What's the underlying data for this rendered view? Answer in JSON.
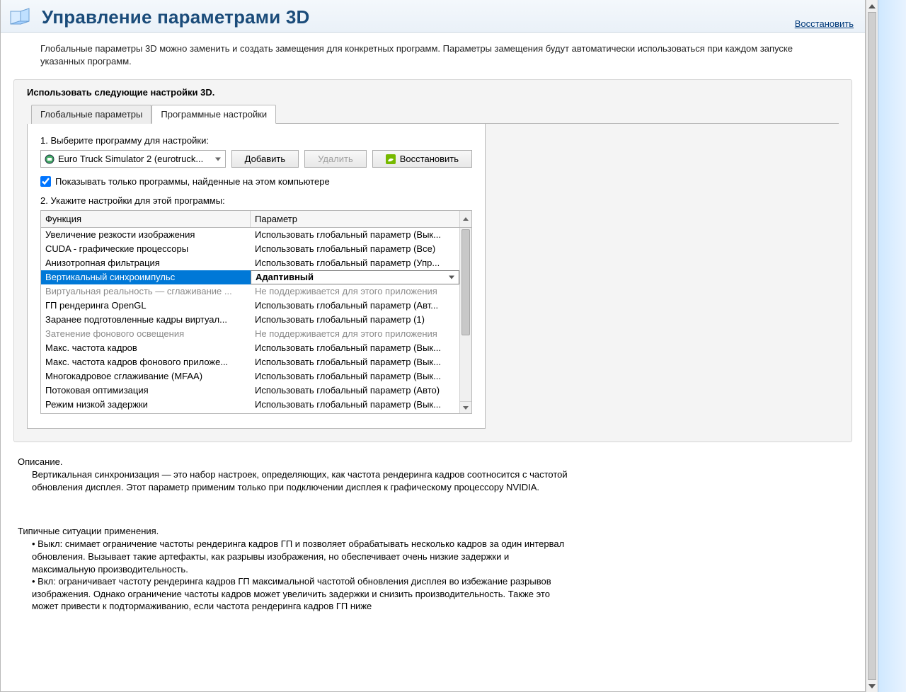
{
  "header": {
    "title": "Управление параметрами 3D",
    "restore_link": "Восстановить"
  },
  "intro": "Глобальные параметры 3D можно заменить и создать замещения для конкретных программ. Параметры замещения будут автоматически использоваться при каждом запуске указанных программ.",
  "group_title": "Использовать следующие настройки 3D.",
  "tabs": {
    "global": "Глобальные параметры",
    "program": "Программные настройки"
  },
  "step1": {
    "label": "1. Выберите программу для настройки:",
    "selected_program": "Euro Truck Simulator 2 (eurotruck...",
    "add_btn": "Добавить",
    "remove_btn": "Удалить",
    "restore_btn": "Восстановить"
  },
  "checkbox_label": "Показывать только программы, найденные на этом компьютере",
  "step2_label": "2. Укажите настройки для этой программы:",
  "table": {
    "col1": "Функция",
    "col2": "Параметр"
  },
  "rows": [
    {
      "f": "Увеличение резкости изображения",
      "p": "Использовать глобальный параметр (Вык...",
      "state": "n"
    },
    {
      "f": "CUDA - графические процессоры",
      "p": "Использовать глобальный параметр (Все)",
      "state": "n"
    },
    {
      "f": "Анизотропная фильтрация",
      "p": "Использовать глобальный параметр (Упр...",
      "state": "n"
    },
    {
      "f": "Вертикальный синхроимпульс",
      "p": "Адаптивный",
      "state": "sel"
    },
    {
      "f": "Виртуальная реальность — сглаживание ...",
      "p": "Не поддерживается для этого приложения",
      "state": "dis"
    },
    {
      "f": "ГП рендеринга OpenGL",
      "p": "Использовать глобальный параметр (Авт...",
      "state": "n"
    },
    {
      "f": "Заранее подготовленные кадры виртуал...",
      "p": "Использовать глобальный параметр (1)",
      "state": "n"
    },
    {
      "f": "Затенение фонового освещения",
      "p": "Не поддерживается для этого приложения",
      "state": "dis"
    },
    {
      "f": "Макс. частота кадров",
      "p": "Использовать глобальный параметр (Вык...",
      "state": "n"
    },
    {
      "f": "Макс. частота кадров фонового приложе...",
      "p": "Использовать глобальный параметр (Вык...",
      "state": "n"
    },
    {
      "f": "Многокадровое сглаживание (MFAA)",
      "p": "Использовать глобальный параметр (Вык...",
      "state": "n"
    },
    {
      "f": "Потоковая оптимизация",
      "p": "Использовать глобальный параметр (Авто)",
      "state": "n"
    },
    {
      "f": "Режим низкой задержки",
      "p": "Использовать глобальный параметр (Вык...",
      "state": "n"
    }
  ],
  "description": {
    "heading": "Описание.",
    "body": "Вертикальная синхронизация — это набор настроек, определяющих, как частота рендеринга кадров соотносится с частотой обновления дисплея. Этот параметр применим только при подключении дисплея к графическому процессору NVIDIA."
  },
  "usage": {
    "heading": "Типичные ситуации применения.",
    "body": "• Выкл: снимает ограничение частоты рендеринга кадров ГП и позволяет обрабатывать несколько кадров за один интервал обновления. Вызывает такие артефакты, как разрывы изображения, но обеспечивает очень низкие задержки и максимальную производительность.\n• Вкл: ограничивает частоту рендеринга кадров ГП максимальной частотой обновления дисплея во избежание разрывов изображения. Однако ограничение частоты кадров может увеличить задержки и снизить производительность. Также это может привести к подтормаживанию, если частота рендеринга кадров ГП ниже"
  }
}
